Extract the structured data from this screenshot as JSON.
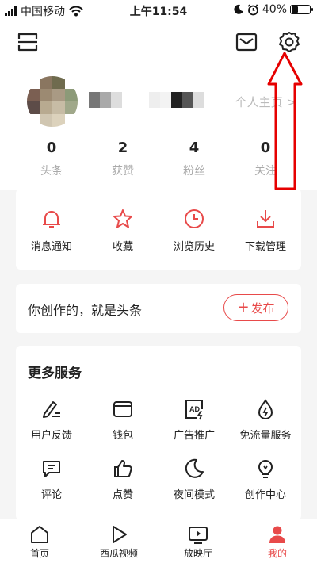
{
  "status_bar": {
    "carrier": "中国移动",
    "time": "上午11:54",
    "battery": "40%",
    "battery_level": 0.4
  },
  "header": {
    "scan_icon": "scan-icon",
    "message_icon": "mail-icon",
    "settings_icon": "gear-icon"
  },
  "profile": {
    "link_label": "个人主页 >"
  },
  "stats": [
    {
      "value": "0",
      "label": "头条"
    },
    {
      "value": "2",
      "label": "获赞"
    },
    {
      "value": "4",
      "label": "粉丝"
    },
    {
      "value": "0",
      "label": "关注"
    }
  ],
  "quick_actions": [
    {
      "label": "消息通知",
      "icon": "bell-icon"
    },
    {
      "label": "收藏",
      "icon": "star-icon"
    },
    {
      "label": "浏览历史",
      "icon": "clock-icon"
    },
    {
      "label": "下载管理",
      "icon": "download-icon"
    }
  ],
  "create": {
    "text": "你创作的，就是头条",
    "publish_label": "发布",
    "publish_icon": "plus"
  },
  "services": {
    "title": "更多服务",
    "items": [
      {
        "label": "用户反馈",
        "icon": "pen-icon"
      },
      {
        "label": "钱包",
        "icon": "wallet-icon"
      },
      {
        "label": "广告推广",
        "icon": "ad-icon"
      },
      {
        "label": "免流量服务",
        "icon": "drop-icon"
      },
      {
        "label": "评论",
        "icon": "comment-icon"
      },
      {
        "label": "点赞",
        "icon": "thumbs-up-icon"
      },
      {
        "label": "夜间模式",
        "icon": "moon-icon"
      },
      {
        "label": "创作中心",
        "icon": "bulb-icon"
      }
    ]
  },
  "tabbar": [
    {
      "label": "首页",
      "icon": "home-icon"
    },
    {
      "label": "西瓜视频",
      "icon": "play-icon"
    },
    {
      "label": "放映厅",
      "icon": "tv-icon"
    },
    {
      "label": "我的",
      "icon": "user-icon",
      "active": true
    }
  ],
  "colors": {
    "accent": "#e84a4a",
    "annotation": "#e60000"
  }
}
